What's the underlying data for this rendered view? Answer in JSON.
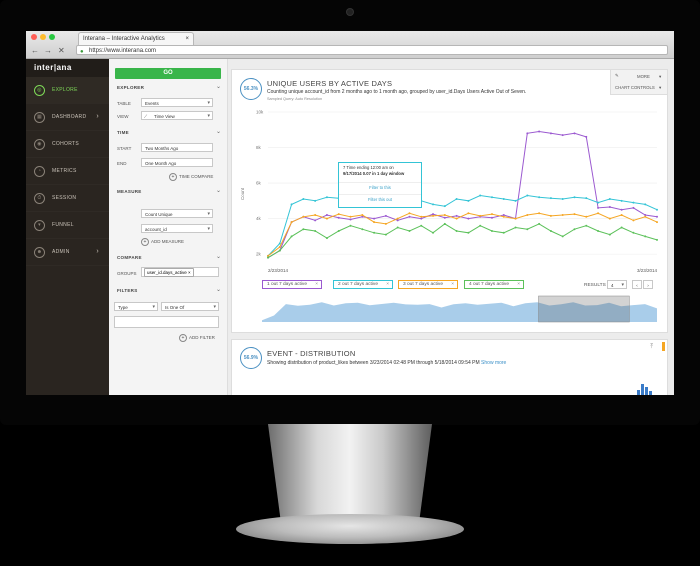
{
  "browser": {
    "tab_title": "Interana – Interactive Analytics",
    "tab_close": "×",
    "url": "https://www.interana.com",
    "back": "←",
    "forward": "→",
    "stop": "✕"
  },
  "sidebar": {
    "logo": "inter|ana",
    "items": [
      {
        "label": "EXPLORE",
        "icon": "compass-icon",
        "glyph": "◎",
        "active": true,
        "chevron": ""
      },
      {
        "label": "DASHBOARD",
        "icon": "dashboard-icon",
        "glyph": "▦",
        "active": false,
        "chevron": "›"
      },
      {
        "label": "COHORTS",
        "icon": "cohorts-icon",
        "glyph": "◉",
        "active": false,
        "chevron": ""
      },
      {
        "label": "METRICS",
        "icon": "metrics-icon",
        "glyph": "◔",
        "active": false,
        "chevron": ""
      },
      {
        "label": "SESSION",
        "icon": "session-icon",
        "glyph": "⏱",
        "active": false,
        "chevron": ""
      },
      {
        "label": "FUNNEL",
        "icon": "funnel-icon",
        "glyph": "▾",
        "active": false,
        "chevron": ""
      },
      {
        "label": "ADMIN",
        "icon": "user-icon",
        "glyph": "☻",
        "active": false,
        "chevron": "›"
      }
    ]
  },
  "query": {
    "go": "GO",
    "explorer": "EXPLORER",
    "table_label": "TABLE",
    "table_value": "Events",
    "view_label": "VIEW",
    "view_value": "Time View",
    "time": "TIME",
    "start_label": "START",
    "start_value": "Two Months Ago",
    "end_label": "END",
    "end_value": "One Month Ago",
    "time_compare": "TIME COMPARE",
    "measure": "MEASURE",
    "measure_value": "Count Unique",
    "measure_column": "account_id",
    "add_measure": "ADD MEASURE",
    "compare": "COMPARE",
    "groups_label": "GROUPS",
    "groups_tag": "user_id.days_active",
    "filters": "FILTERS",
    "filter_type": "Type",
    "filter_op": "Is One Of",
    "add_filter": "ADD FILTER"
  },
  "card1": {
    "badge": "56.3%",
    "title": "UNIQUE USERS BY ACTIVE DAYS",
    "subtitle": "Counting unique account_id from 2 months ago to 1 month ago, grouped by user_id.Days Users Active Out of Seven.",
    "small": "Sampled Query: Auto Resolution",
    "more": "MORE",
    "chart_controls": "CHART CONTROLS",
    "results_label": "RESULTS",
    "results_value": "4",
    "prev": "‹",
    "next": "›"
  },
  "tooltip": {
    "line1": "7 Time ending 12:00 am on",
    "line2": "9/17/2014  0.07  in 1 day window",
    "filter_to": "Filter to this",
    "filter_out": "Filter this out"
  },
  "card2": {
    "badge": "56.9%",
    "title": "EVENT - DISTRIBUTION",
    "subtitle": "Showing distribution of product_likes between 3/23/2014 02:48 PM through 5/18/2014 09:54 PM",
    "show_more": "Show more"
  },
  "chart_data": {
    "type": "line",
    "ylabel": "Count",
    "yticks": [
      "2k",
      "4k",
      "6k",
      "8k",
      "10k"
    ],
    "ylim": [
      1500,
      10000
    ],
    "x_start_label": "2/23/2014",
    "x_end_label": "3/23/2014",
    "grid": true,
    "series": [
      {
        "name": "1 out 7 days active",
        "color": "#9b59d0",
        "values": [
          1800,
          2200,
          3800,
          4100,
          3900,
          4200,
          4050,
          3950,
          4100,
          4000,
          4150,
          3900,
          4100,
          4000,
          4250,
          4050,
          4150,
          4000,
          4100,
          4050,
          4200,
          4000,
          8800,
          8900,
          8800,
          8700,
          8800,
          8600,
          4600,
          4650,
          4500,
          4600,
          4200,
          4100
        ]
      },
      {
        "name": "2 out 7 days active",
        "color": "#34c4d6",
        "values": [
          1900,
          2600,
          4800,
          5100,
          5000,
          5200,
          5150,
          5300,
          5100,
          5200,
          5150,
          5100,
          5400,
          5000,
          4800,
          4700,
          5100,
          5000,
          5300,
          5200,
          5100,
          5000,
          5300,
          5200,
          5150,
          5100,
          5200,
          5150,
          4900,
          5100,
          5000,
          4900,
          4800,
          4500
        ]
      },
      {
        "name": "3 out 7 days active",
        "color": "#f5a623",
        "values": [
          1900,
          2400,
          3800,
          4100,
          4200,
          4000,
          4250,
          4100,
          4200,
          3800,
          3700,
          4000,
          4300,
          4100,
          4150,
          4200,
          4000,
          4300,
          4150,
          4250,
          4100,
          4000,
          4200,
          4300,
          4150,
          4200,
          4250,
          4100,
          4300,
          4000,
          4200,
          3900,
          4100,
          3800
        ]
      },
      {
        "name": "4 out 7 days active",
        "color": "#5cc15a",
        "values": [
          1800,
          2200,
          3000,
          3400,
          3300,
          2900,
          3300,
          3600,
          3400,
          3200,
          3100,
          3500,
          3300,
          3600,
          3200,
          3700,
          3300,
          3200,
          3600,
          3300,
          3200,
          3500,
          3400,
          3700,
          3300,
          3000,
          3400,
          3600,
          3300,
          3100,
          3500,
          3200,
          3000,
          2800
        ]
      }
    ],
    "brush": {
      "selected_start_fraction": 0.7,
      "selected_end_fraction": 0.93
    }
  }
}
